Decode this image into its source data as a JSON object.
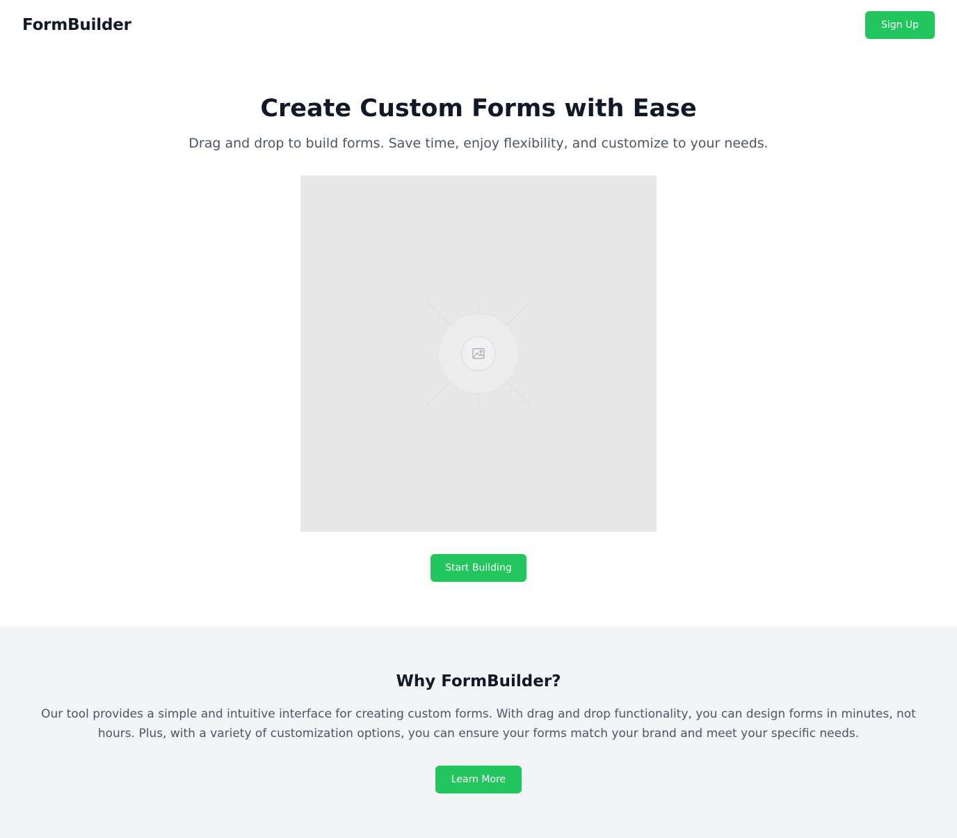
{
  "header": {
    "logo": "FormBuilder",
    "signup_label": "Sign Up"
  },
  "hero": {
    "title": "Create Custom Forms with Ease",
    "subtitle": "Drag and drop to build forms. Save time, enjoy flexibility, and customize to your needs.",
    "image_icon": "image-icon",
    "cta_label": "Start Building"
  },
  "why": {
    "title": "Why FormBuilder?",
    "body": "Our tool provides a simple and intuitive interface for creating custom forms. With drag and drop functionality, you can design forms in minutes, not hours. Plus, with a variety of customization options, you can ensure your forms match your brand and meet your specific needs.",
    "cta_label": "Learn More"
  },
  "colors": {
    "accent": "#22c55e",
    "heading": "#111827",
    "body_text": "#4b5563",
    "section_bg": "#f2f4f5",
    "placeholder_bg": "#e8e8e8"
  }
}
